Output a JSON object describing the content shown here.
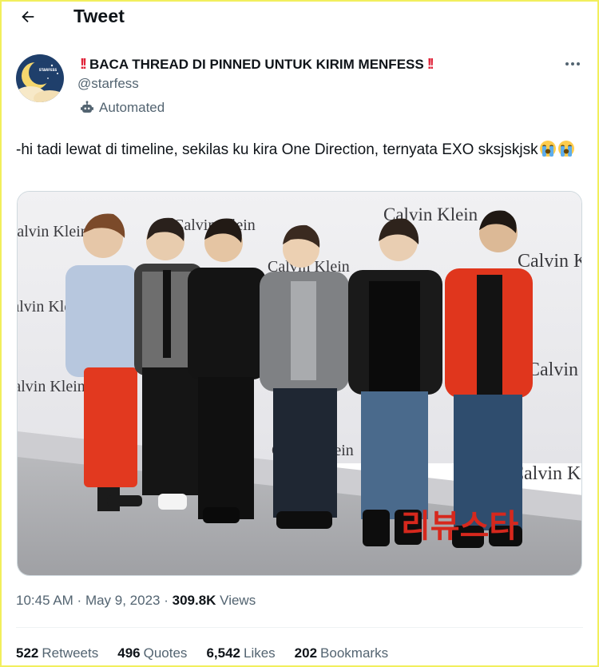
{
  "header": {
    "title": "Tweet"
  },
  "author": {
    "name_prefix": "‼️",
    "name_text": "BACA THREAD DI PINNED UNTUK KIRIM MENFESS",
    "name_suffix": "‼️",
    "handle": "@starfess",
    "automated_label": "Automated",
    "avatar_text": "STARFESS"
  },
  "tweet": {
    "text": "-hi tadi lewat di timeline, sekilas ku kira One Direction, ternyata EXO sksjskjsk"
  },
  "media": {
    "backdrop_brand": "Calvin Klein",
    "watermark": "리뷰스타"
  },
  "meta": {
    "time": "10:45 AM",
    "sep1": " · ",
    "date": "May 9, 2023",
    "sep2": " · ",
    "views_count": "309.8K",
    "views_label": "Views"
  },
  "stats": [
    {
      "count": "522",
      "label": "Retweets"
    },
    {
      "count": "496",
      "label": "Quotes"
    },
    {
      "count": "6,542",
      "label": "Likes"
    },
    {
      "count": "202",
      "label": "Bookmarks"
    }
  ],
  "colors": {
    "text": "#0f1419",
    "secondary": "#536471",
    "alert_red": "#e0243a"
  }
}
